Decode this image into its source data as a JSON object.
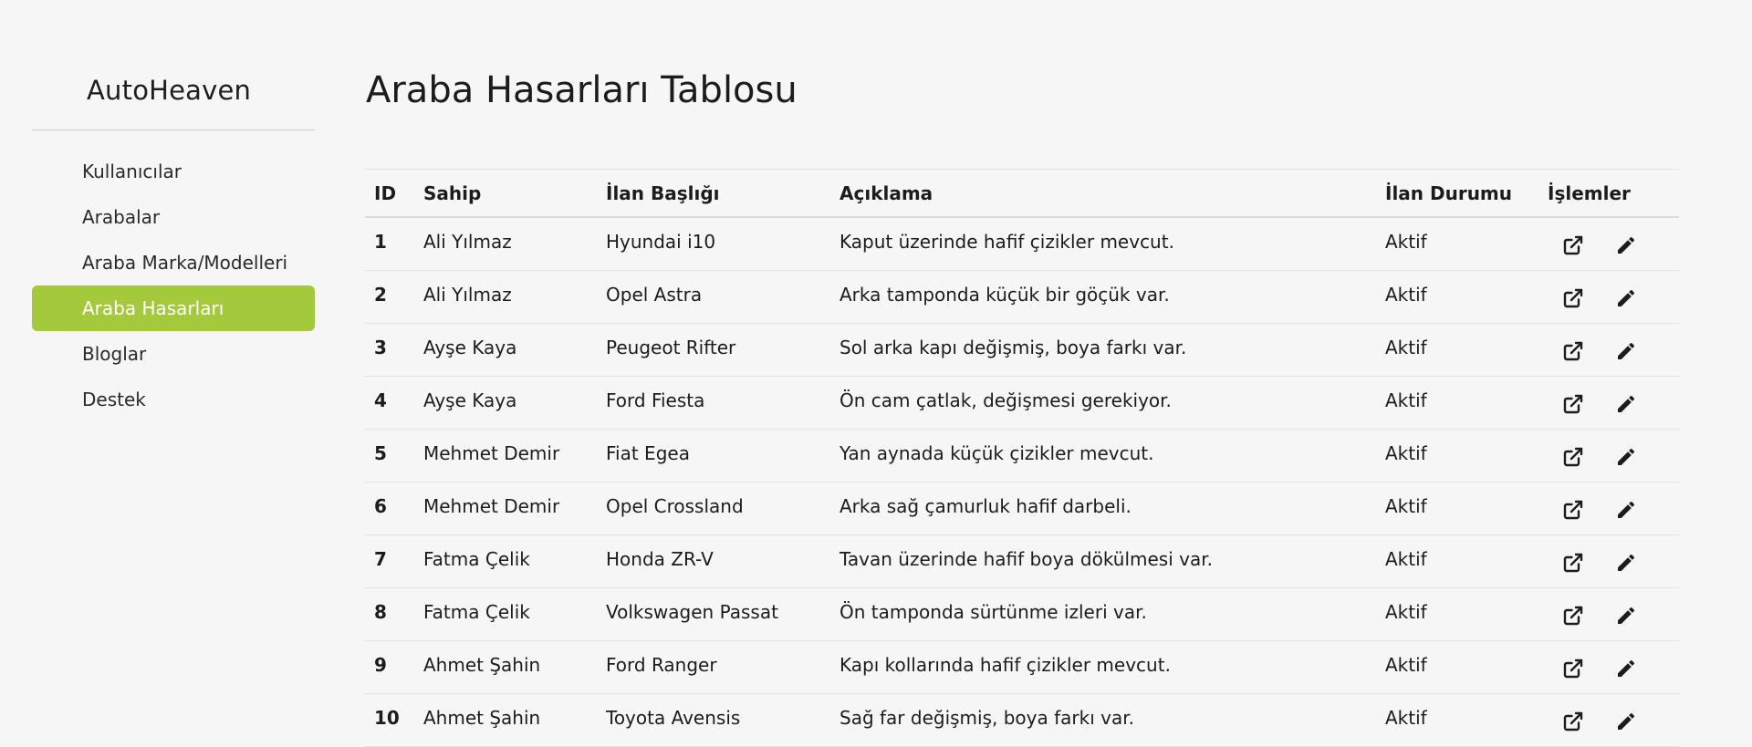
{
  "app": {
    "brand": "AutoHeaven"
  },
  "colors": {
    "accent": "#a5c93c",
    "background": "#f6f6f6",
    "text": "#1c1c1c"
  },
  "sidebar": {
    "items": [
      {
        "label": "Kullanıcılar",
        "active": false
      },
      {
        "label": "Arabalar",
        "active": false
      },
      {
        "label": "Araba Marka/Modelleri",
        "active": false
      },
      {
        "label": "Araba Hasarları",
        "active": true
      },
      {
        "label": "Bloglar",
        "active": false
      },
      {
        "label": "Destek",
        "active": false
      }
    ]
  },
  "main": {
    "title": "Araba Hasarları Tablosu",
    "table": {
      "headers": {
        "id": "ID",
        "owner": "Sahip",
        "listing_title": "İlan Başlığı",
        "description": "Açıklama",
        "status": "İlan Durumu",
        "actions": "İşlemler"
      },
      "action_icons": [
        "external-link-icon",
        "pencil-icon"
      ],
      "rows": [
        {
          "id": "1",
          "owner": "Ali Yılmaz",
          "listing_title": "Hyundai i10",
          "description": "Kaput üzerinde hafif çizikler mevcut.",
          "status": "Aktif"
        },
        {
          "id": "2",
          "owner": "Ali Yılmaz",
          "listing_title": "Opel Astra",
          "description": "Arka tamponda küçük bir göçük var.",
          "status": "Aktif"
        },
        {
          "id": "3",
          "owner": "Ayşe Kaya",
          "listing_title": "Peugeot Rifter",
          "description": "Sol arka kapı değişmiş, boya farkı var.",
          "status": "Aktif"
        },
        {
          "id": "4",
          "owner": "Ayşe Kaya",
          "listing_title": "Ford Fiesta",
          "description": "Ön cam çatlak, değişmesi gerekiyor.",
          "status": "Aktif"
        },
        {
          "id": "5",
          "owner": "Mehmet Demir",
          "listing_title": "Fiat Egea",
          "description": "Yan aynada küçük çizikler mevcut.",
          "status": "Aktif"
        },
        {
          "id": "6",
          "owner": "Mehmet Demir",
          "listing_title": "Opel Crossland",
          "description": "Arka sağ çamurluk hafif darbeli.",
          "status": "Aktif"
        },
        {
          "id": "7",
          "owner": "Fatma Çelik",
          "listing_title": "Honda ZR-V",
          "description": "Tavan üzerinde hafif boya dökülmesi var.",
          "status": "Aktif"
        },
        {
          "id": "8",
          "owner": "Fatma Çelik",
          "listing_title": "Volkswagen Passat",
          "description": "Ön tamponda sürtünme izleri var.",
          "status": "Aktif"
        },
        {
          "id": "9",
          "owner": "Ahmet Şahin",
          "listing_title": "Ford Ranger",
          "description": "Kapı kollarında hafif çizikler mevcut.",
          "status": "Aktif"
        },
        {
          "id": "10",
          "owner": "Ahmet Şahin",
          "listing_title": "Toyota Avensis",
          "description": "Sağ far değişmiş, boya farkı var.",
          "status": "Aktif"
        }
      ]
    }
  }
}
